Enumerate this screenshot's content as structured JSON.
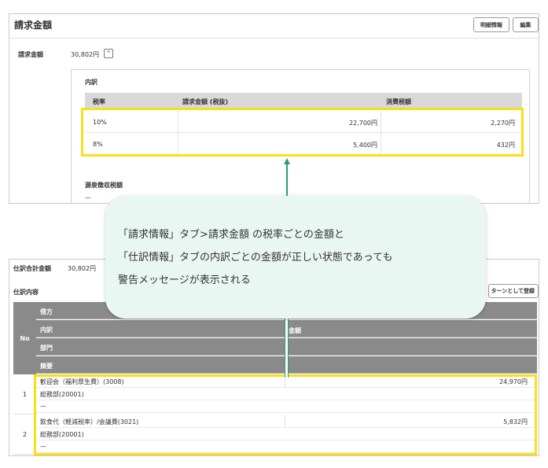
{
  "billing": {
    "title": "請求金額",
    "detail_button": "明細情報",
    "edit_button": "編集",
    "amount_label": "請求金額",
    "amount_value": "30,802円",
    "toggle_glyph": "^",
    "breakdown_title": "内訳",
    "columns": [
      "税率",
      "請求金額 (税抜)",
      "消費税額"
    ],
    "rows": [
      {
        "rate": "10%",
        "amount": "22,700円",
        "tax": "2,270円"
      },
      {
        "rate": "8%",
        "amount": "5,400円",
        "tax": "432円"
      }
    ],
    "withholding_label": "源泉徴収税額",
    "withholding_value": "—"
  },
  "journal": {
    "total_label": "仕訳合計金額",
    "total_value": "30,802円",
    "section_label": "仕訳内容",
    "pattern_button": "ターンとして登録",
    "no_header": "No",
    "header_rows": [
      "借方",
      "内訳",
      "部門",
      "摘要"
    ],
    "amount_header": "金額",
    "entries": [
      {
        "no": "1",
        "account": "歓迎会（福利厚生費）(3008)",
        "amount": "24,970円",
        "department": "総務部(20001)",
        "memo": "—"
      },
      {
        "no": "2",
        "account": "飲食代（軽減税率）/会議費(3021)",
        "amount": "5,832円",
        "department": "総務部(20001)",
        "memo": "—"
      }
    ]
  },
  "callout": {
    "line1": "「請求情報」タブ>請求金額 の税率ごとの金額と",
    "line2": "「仕訳情報」タブの内訳ごとの金額が正しい状態であっても",
    "line3": "警告メッセージが表示される"
  },
  "colors": {
    "highlight": "#f7e01a",
    "callout_bg": "#e9f7f2",
    "connector": "#2e9b73",
    "table_header_dark": "#8a8a8a",
    "table_header_light": "#d9d9d9"
  }
}
